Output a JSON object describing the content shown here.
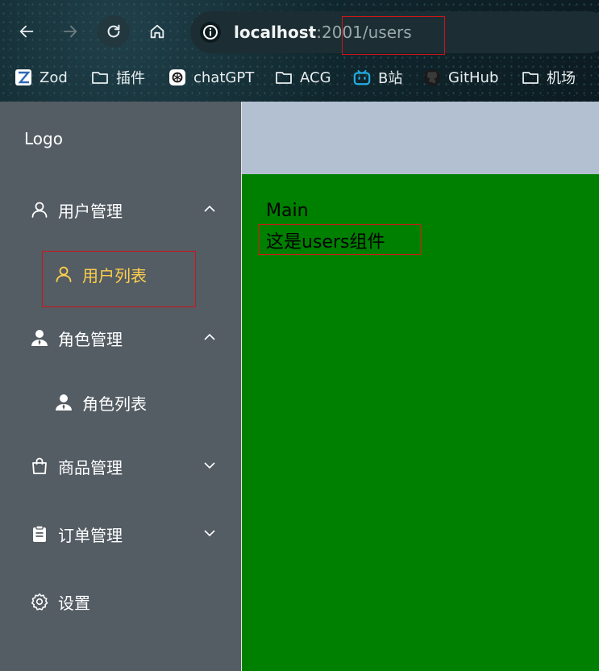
{
  "browser": {
    "url_host": "localhost",
    "url_rest": ":2001/users",
    "bookmarks": [
      {
        "label": "Zod",
        "icon": "zod-icon"
      },
      {
        "label": "插件",
        "icon": "folder-icon"
      },
      {
        "label": "chatGPT",
        "icon": "openai-icon"
      },
      {
        "label": "ACG",
        "icon": "folder-icon"
      },
      {
        "label": "B站",
        "icon": "bilibili-icon"
      },
      {
        "label": "GitHub",
        "icon": "github-icon"
      },
      {
        "label": "机场",
        "icon": "folder-icon"
      }
    ]
  },
  "sidebar": {
    "logo": "Logo",
    "menus": [
      {
        "label": "用户管理",
        "icon": "user-icon",
        "expanded": true
      },
      {
        "label": "用户列表",
        "icon": "user-icon",
        "active": true
      },
      {
        "label": "角色管理",
        "icon": "avatar-filled-icon",
        "expanded": true
      },
      {
        "label": "角色列表",
        "icon": "avatar-filled-icon"
      },
      {
        "label": "商品管理",
        "icon": "shopping-bag-icon",
        "expanded": false
      },
      {
        "label": "订单管理",
        "icon": "clipboard-icon",
        "expanded": false
      },
      {
        "label": "设置",
        "icon": "gear-icon"
      }
    ]
  },
  "main": {
    "title": "Main",
    "text": "这是users组件"
  },
  "colors": {
    "sidebar_bg": "#545c64",
    "active_text": "#ffd04b",
    "header_bg": "#b3c0d1",
    "main_bg": "#008000",
    "highlight_border": "#d0141a"
  }
}
